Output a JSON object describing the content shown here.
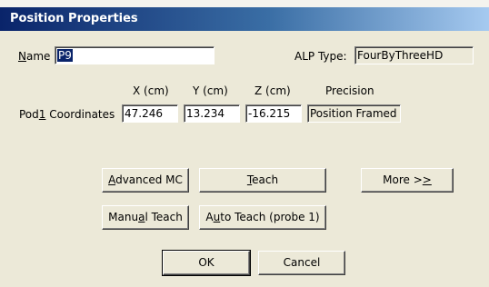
{
  "window": {
    "title": "Position Properties"
  },
  "name_field": {
    "label_u": "N",
    "label_rest": "ame",
    "value": "P9"
  },
  "alp": {
    "label": "ALP Type:",
    "value": "FourByThreeHD"
  },
  "coords": {
    "headers": {
      "x": "X (cm)",
      "y": "Y (cm)",
      "z": "Z (cm)",
      "precision": "Precision"
    },
    "row_label_pre": "Pod",
    "row_label_u": "1",
    "row_label_post": " Coordinates",
    "x": "47.246",
    "y": "13.234",
    "z": "-16.215",
    "precision": "Position Framed"
  },
  "buttons": {
    "advanced_mc": {
      "pre": "",
      "u": "A",
      "post": "dvanced MC"
    },
    "teach": {
      "pre": "",
      "u": "T",
      "post": "each"
    },
    "more": {
      "pre": "More >",
      "u": ">",
      "post": ""
    },
    "manual_teach": {
      "pre": "Manu",
      "u": "a",
      "post": "l Teach"
    },
    "auto_teach": {
      "pre": "A",
      "u": "u",
      "post": "to Teach (probe 1)"
    },
    "ok": "OK",
    "cancel": "Cancel"
  }
}
